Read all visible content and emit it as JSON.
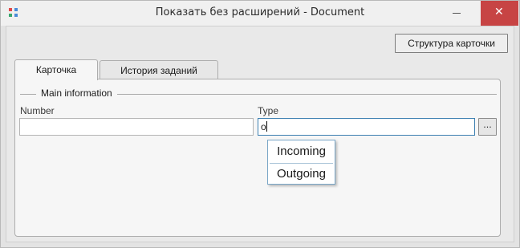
{
  "window": {
    "title": "Показать без расширений - Document",
    "close_glyph": "✕",
    "icon": "tiles-app-icon",
    "icon_colors": [
      "#e24848",
      "#4a8bd8",
      "#3aa76d",
      "#e2a23b"
    ]
  },
  "toolbar": {
    "card_structure_label": "Структура карточки"
  },
  "tabs": [
    {
      "label": "Карточка",
      "active": true
    },
    {
      "label": "История заданий",
      "active": false
    }
  ],
  "group": {
    "title": "Main information"
  },
  "fields": {
    "number": {
      "label": "Number",
      "value": ""
    },
    "type": {
      "label": "Type",
      "value": "o",
      "button_label": "..."
    }
  },
  "dropdown": {
    "items": [
      "Incoming",
      "Outgoing"
    ]
  },
  "colors": {
    "focus_border": "#3c7fb1",
    "close_button": "#c74444"
  }
}
